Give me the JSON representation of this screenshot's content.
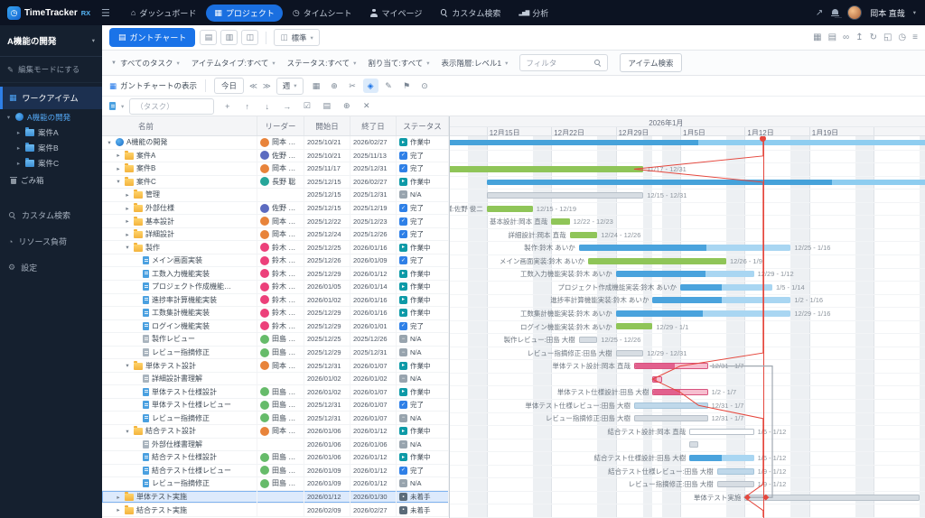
{
  "app": {
    "title": "TimeTracker",
    "title_suffix": "RX"
  },
  "header": {
    "nav": [
      {
        "label": "ダッシュボード",
        "icon": "home-icon",
        "active": false
      },
      {
        "label": "プロジェクト",
        "icon": "grid-icon",
        "active": true
      },
      {
        "label": "タイムシート",
        "icon": "timesheet-icon",
        "active": false
      },
      {
        "label": "マイページ",
        "icon": "user-icon",
        "active": false
      },
      {
        "label": "カスタム検索",
        "icon": "search-icon",
        "active": false
      },
      {
        "label": "分析",
        "icon": "chart-icon",
        "active": false
      }
    ],
    "user_name": "岡本 直哉"
  },
  "sidebar": {
    "project_selector": "A機能の開発",
    "edit_mode_label": "編集モードにする",
    "workitem_label": "ワークアイテム",
    "tree": [
      {
        "label": "A機能の開発",
        "level": 0,
        "selected": true,
        "expanded": true,
        "icon": "project-icon"
      },
      {
        "label": "案件A",
        "level": 1,
        "icon": "folder-icon"
      },
      {
        "label": "案件B",
        "level": 1,
        "icon": "folder-icon"
      },
      {
        "label": "案件C",
        "level": 1,
        "icon": "folder-icon"
      }
    ],
    "trash_label": "ごみ箱",
    "menu": [
      {
        "label": "カスタム検索",
        "icon": "search-icon"
      },
      {
        "label": "リソース負荷",
        "icon": "load-icon"
      },
      {
        "label": "設定",
        "icon": "gear-icon"
      }
    ]
  },
  "toolbar": {
    "view_button": "ガントチャート",
    "view_icons": [
      "list-icon",
      "board-icon",
      "columns-icon"
    ],
    "preset": "標準",
    "right_icons": [
      "grid-icon",
      "list-icon",
      "link-icon",
      "upload-icon",
      "refresh-icon",
      "frame-icon",
      "clock-icon",
      "menu-icon"
    ]
  },
  "filters": {
    "chips": [
      "すべてのタスク",
      "アイテムタイプ:すべて",
      "ステータス:すべて",
      "割り当て:すべて",
      "表示階層:レベル1"
    ],
    "filter_placeholder": "フィルタ",
    "search_button": "アイテム検索"
  },
  "gantt_toolbar": {
    "show_label": "ガントチャートの表示",
    "today_button": "今日",
    "zoom_level": "週",
    "icons": [
      "grid-icon",
      "zoom-icon",
      "scissors-icon",
      "diamond-icon",
      "pen-icon",
      "flag-icon",
      "comment-icon"
    ],
    "active_icon_index": 3
  },
  "row_toolbar": {
    "task_placeholder": "（タスク）",
    "icons": [
      "plus-icon",
      "up-icon",
      "down-icon",
      "indent-icon",
      "check-icon",
      "list-icon",
      "zoom-icon",
      "close-icon"
    ]
  },
  "table": {
    "columns": [
      "名前",
      "リーダー",
      "開始日",
      "終了日",
      "ステータス"
    ],
    "rows": [
      {
        "name": "A機能の開発",
        "level": 0,
        "icon": "project",
        "expand": "open",
        "leader": "岡本 直哉",
        "start": "2025/10/21",
        "end": "2026/02/27",
        "status": "作業中"
      },
      {
        "name": "案件A",
        "level": 1,
        "icon": "folder",
        "expand": "closed",
        "leader": "佐野 俊二",
        "start": "2025/10/21",
        "end": "2025/11/13",
        "status": "完了"
      },
      {
        "name": "案件B",
        "level": 1,
        "icon": "folder",
        "expand": "closed",
        "leader": "岡本 直哉",
        "start": "2025/11/17",
        "end": "2025/12/31",
        "status": "完了"
      },
      {
        "name": "案件C",
        "level": 1,
        "icon": "folder",
        "expand": "open",
        "leader": "長野 聡",
        "start": "2025/12/15",
        "end": "2026/02/27",
        "status": "作業中"
      },
      {
        "name": "管理",
        "level": 2,
        "icon": "folder",
        "expand": "closed",
        "leader": "",
        "start": "2025/12/15",
        "end": "2025/12/31",
        "status": "N/A"
      },
      {
        "name": "外部仕様",
        "level": 2,
        "icon": "folder",
        "expand": "closed",
        "leader": "佐野 俊二",
        "start": "2025/12/15",
        "end": "2025/12/19",
        "status": "完了"
      },
      {
        "name": "基本設計",
        "level": 2,
        "icon": "folder",
        "expand": "closed",
        "leader": "岡本 直哉",
        "start": "2025/12/22",
        "end": "2025/12/23",
        "status": "完了"
      },
      {
        "name": "詳細設計",
        "level": 2,
        "icon": "folder",
        "expand": "closed",
        "leader": "岡本 直哉",
        "start": "2025/12/24",
        "end": "2025/12/26",
        "status": "完了"
      },
      {
        "name": "製作",
        "level": 2,
        "icon": "folder",
        "expand": "open",
        "leader": "鈴木 あ…",
        "start": "2025/12/25",
        "end": "2026/01/16",
        "status": "作業中"
      },
      {
        "name": "メイン画面実装",
        "level": 3,
        "icon": "doc",
        "leader": "鈴木 あ…",
        "start": "2025/12/26",
        "end": "2026/01/09",
        "status": "完了"
      },
      {
        "name": "工数入力機能実装",
        "level": 3,
        "icon": "doc",
        "leader": "鈴木 あ…",
        "start": "2025/12/29",
        "end": "2026/01/12",
        "status": "作業中"
      },
      {
        "name": "プロジェクト作成機能…",
        "level": 3,
        "icon": "doc",
        "leader": "鈴木 あ…",
        "start": "2026/01/05",
        "end": "2026/01/14",
        "status": "作業中"
      },
      {
        "name": "進捗率計算機能実装",
        "level": 3,
        "icon": "doc",
        "leader": "鈴木 あ…",
        "start": "2026/01/02",
        "end": "2026/01/16",
        "status": "作業中"
      },
      {
        "name": "工数集計機能実装",
        "level": 3,
        "icon": "doc",
        "leader": "鈴木 あ…",
        "start": "2025/12/29",
        "end": "2026/01/16",
        "status": "作業中"
      },
      {
        "name": "ログイン機能実装",
        "level": 3,
        "icon": "doc",
        "leader": "鈴木 あ…",
        "start": "2025/12/29",
        "end": "2026/01/01",
        "status": "完了"
      },
      {
        "name": "製作レビュー",
        "level": 3,
        "icon": "doc-gray",
        "leader": "田島 大樹",
        "start": "2025/12/25",
        "end": "2025/12/26",
        "status": "N/A"
      },
      {
        "name": "レビュー指摘修正",
        "level": 3,
        "icon": "doc-gray",
        "leader": "田島 大樹",
        "start": "2025/12/29",
        "end": "2025/12/31",
        "status": "N/A"
      },
      {
        "name": "単体テスト設計",
        "level": 2,
        "icon": "folder",
        "expand": "open",
        "leader": "岡本 直哉",
        "start": "2025/12/31",
        "end": "2026/01/07",
        "status": "作業中"
      },
      {
        "name": "詳細設計書理解",
        "level": 3,
        "icon": "doc-gray",
        "leader": "",
        "start": "2026/01/02",
        "end": "2026/01/02",
        "status": "N/A"
      },
      {
        "name": "単体テスト仕様設計",
        "level": 3,
        "icon": "doc",
        "leader": "田島 大樹",
        "start": "2026/01/02",
        "end": "2026/01/07",
        "status": "作業中"
      },
      {
        "name": "単体テスト仕様レビュー",
        "level": 3,
        "icon": "doc",
        "leader": "田島 大樹",
        "start": "2025/12/31",
        "end": "2026/01/07",
        "status": "完了"
      },
      {
        "name": "レビュー指摘修正",
        "level": 3,
        "icon": "doc",
        "leader": "田島 大樹",
        "start": "2025/12/31",
        "end": "2026/01/07",
        "status": "N/A"
      },
      {
        "name": "結合テスト設計",
        "level": 2,
        "icon": "folder",
        "expand": "open",
        "leader": "岡本 直哉",
        "start": "2026/01/06",
        "end": "2026/01/12",
        "status": "作業中"
      },
      {
        "name": "外部仕様書理解",
        "level": 3,
        "icon": "doc-gray",
        "leader": "",
        "start": "2026/01/06",
        "end": "2026/01/06",
        "status": "N/A"
      },
      {
        "name": "結合テスト仕様設計",
        "level": 3,
        "icon": "doc",
        "leader": "田島 大樹",
        "start": "2026/01/06",
        "end": "2026/01/12",
        "status": "作業中"
      },
      {
        "name": "結合テスト仕様レビュー",
        "level": 3,
        "icon": "doc",
        "leader": "田島 大樹",
        "start": "2026/01/09",
        "end": "2026/01/12",
        "status": "完了"
      },
      {
        "name": "レビュー指摘修正",
        "level": 3,
        "icon": "doc",
        "leader": "田島 大樹",
        "start": "2026/01/09",
        "end": "2026/01/12",
        "status": "N/A"
      },
      {
        "name": "単体テスト実施",
        "level": 1,
        "icon": "folder",
        "expand": "closed",
        "leader": "",
        "start": "2026/01/12",
        "end": "2026/01/30",
        "status": "未着手",
        "selected": true
      },
      {
        "name": "結合テスト実施",
        "level": 1,
        "icon": "folder",
        "expand": "closed",
        "leader": "",
        "start": "2026/02/09",
        "end": "2026/02/27",
        "status": "未着手"
      }
    ]
  },
  "status_colors": {
    "完了": "#2f80e7",
    "作業中": "#0e9aa7",
    "N/A": "#98a4ae",
    "未着手": "#5b6b79"
  },
  "chart_data": {
    "type": "gantt",
    "timeline": {
      "visible_start": "2025-12-11",
      "day_width": 10.2,
      "months": [
        {
          "date": "2026-01-01",
          "label": "2026年1月"
        }
      ],
      "weeks": [
        {
          "date": "2025-12-15",
          "label": "12月15日"
        },
        {
          "date": "2025-12-22",
          "label": "12月22日"
        },
        {
          "date": "2025-12-29",
          "label": "12月29日"
        },
        {
          "date": "2026-01-05",
          "label": "1月5日"
        },
        {
          "date": "2026-01-12",
          "label": "1月12日"
        },
        {
          "date": "2026-01-19",
          "label": "1月19日"
        }
      ],
      "holidays": [
        "2026-01-01"
      ]
    },
    "today": "2026-01-14",
    "bars": [
      {
        "row": 0,
        "start": "2025-10-21",
        "end": "2026-02-27",
        "color": "summary",
        "progress": 0.6
      },
      {
        "row": 1,
        "start": "2025-10-21",
        "end": "2025-11-13",
        "color": "green",
        "progress": 1
      },
      {
        "row": 2,
        "start": "2025-11-17",
        "end": "2025-12-31",
        "color": "green",
        "progress": 1,
        "label_right": "11/17 - 12/31"
      },
      {
        "row": 3,
        "start": "2025-12-15",
        "end": "2026-02-27",
        "color": "summary",
        "progress": 0.5
      },
      {
        "row": 4,
        "start": "2025-12-15",
        "end": "2025-12-31",
        "color": "gray",
        "label_right": "12/15 - 12/31"
      },
      {
        "row": 5,
        "start": "2025-12-15",
        "end": "2025-12-19",
        "color": "green",
        "progress": 1,
        "label_left": "外部仕様:佐野 俊二",
        "label_right": "12/15 - 12/19"
      },
      {
        "row": 6,
        "start": "2025-12-22",
        "end": "2025-12-23",
        "color": "green",
        "progress": 1,
        "label_left": "基本設計:岡本 直哉",
        "label_right": "12/22 - 12/23"
      },
      {
        "row": 7,
        "start": "2025-12-24",
        "end": "2025-12-26",
        "color": "green",
        "progress": 1,
        "label_left": "詳細設計:岡本 直哉",
        "label_right": "12/24 - 12/26"
      },
      {
        "row": 8,
        "start": "2025-12-25",
        "end": "2026-01-16",
        "color": "blue",
        "progress": 0.6,
        "label_left": "製作:鈴木 あいか",
        "label_right": "12/25 - 1/16"
      },
      {
        "row": 9,
        "start": "2025-12-26",
        "end": "2026-01-09",
        "color": "green",
        "progress": 1,
        "label_left": "メイン画面実装:鈴木 あいか",
        "label_right": "12/26 - 1/9"
      },
      {
        "row": 10,
        "start": "2025-12-29",
        "end": "2026-01-12",
        "color": "blue",
        "progress": 0.65,
        "label_left": "工数入力機能実装:鈴木 あいか",
        "label_right": "12/29 - 1/12"
      },
      {
        "row": 11,
        "start": "2026-01-05",
        "end": "2026-01-14",
        "color": "blue",
        "progress": 0.45,
        "label_left": "プロジェクト作成機能実装:鈴木 あいか",
        "label_right": "1/5 - 1/14"
      },
      {
        "row": 12,
        "start": "2026-01-02",
        "end": "2026-01-16",
        "color": "blue",
        "progress": 0.5,
        "label_left": "進捗率計算機能実装:鈴木 あいか",
        "label_right": "1/2 - 1/16"
      },
      {
        "row": 13,
        "start": "2025-12-29",
        "end": "2026-01-16",
        "color": "blue",
        "progress": 0.5,
        "label_left": "工数集計機能実装:鈴木 あいか",
        "label_right": "12/29 - 1/16"
      },
      {
        "row": 14,
        "start": "2025-12-29",
        "end": "2026-01-01",
        "color": "green",
        "progress": 1,
        "label_left": "ログイン機能実装:鈴木 あいか",
        "label_right": "12/29 - 1/1"
      },
      {
        "row": 15,
        "start": "2025-12-25",
        "end": "2025-12-26",
        "color": "gray",
        "label_left": "製作レビュー:田島 大樹",
        "label_right": "12/25 - 12/26"
      },
      {
        "row": 16,
        "start": "2025-12-29",
        "end": "2025-12-31",
        "color": "gray",
        "label_left": "レビュー指摘修正:田島 大樹",
        "label_right": "12/29 - 12/31"
      },
      {
        "row": 17,
        "start": "2025-12-31",
        "end": "2026-01-07",
        "color": "pink",
        "progress": 0.55,
        "label_left": "単体テスト設計:岡本 直哉",
        "label_right": "12/31 - 1/7"
      },
      {
        "row": 18,
        "start": "2026-01-02",
        "end": "2026-01-02",
        "color": "pink",
        "progress": 0.5
      },
      {
        "row": 19,
        "start": "2026-01-02",
        "end": "2026-01-07",
        "color": "pink",
        "progress": 0.5,
        "label_left": "単体テスト仕様設計:田島 大樹",
        "label_right": "1/2 - 1/7"
      },
      {
        "row": 20,
        "start": "2025-12-31",
        "end": "2026-01-07",
        "color": "grayblue",
        "label_left": "単体テスト仕様レビュー:田島 大樹",
        "label_right": "12/31 - 1/7"
      },
      {
        "row": 21,
        "start": "2025-12-31",
        "end": "2026-01-07",
        "color": "gray",
        "label_left": "レビュー指摘修正:田島 大樹",
        "label_right": "12/31 - 1/7"
      },
      {
        "row": 22,
        "start": "2026-01-06",
        "end": "2026-01-12",
        "color": "outline",
        "label_left": "結合テスト設計:岡本 直哉",
        "label_right": "1/6 - 1/12"
      },
      {
        "row": 23,
        "start": "2026-01-06",
        "end": "2026-01-06",
        "color": "gray"
      },
      {
        "row": 24,
        "start": "2026-01-06",
        "end": "2026-01-12",
        "color": "blue",
        "progress": 0.5,
        "label_left": "結合テスト仕様設計:田島 大樹",
        "label_right": "1/6 - 1/12"
      },
      {
        "row": 25,
        "start": "2026-01-09",
        "end": "2026-01-12",
        "color": "grayblue",
        "label_left": "結合テスト仕様レビュー:田島 大樹",
        "label_right": "1/9 - 1/12"
      },
      {
        "row": 26,
        "start": "2026-01-09",
        "end": "2026-01-12",
        "color": "gray",
        "label_left": "レビュー指摘修正:田島 大樹",
        "label_right": "1/9 - 1/12"
      },
      {
        "row": 27,
        "start": "2026-01-12",
        "end": "2026-01-30",
        "color": "gray",
        "label_left": "単体テスト実施"
      },
      {
        "row": 28,
        "start": "2026-02-09",
        "end": "2026-02-27",
        "color": "gray"
      }
    ],
    "progress_line": {
      "2": "2025-12-31",
      "17": "2026-01-05",
      "18": "2026-01-02",
      "19": "2026-01-05",
      "20": "2026-01-07",
      "27": "2026-01-12"
    },
    "connectors": [
      {
        "from_row": 17,
        "via_date": "2026-01-15",
        "to_row": 27,
        "to_date": "2026-01-12"
      }
    ],
    "markers": [
      {
        "row": 27,
        "date": "2026-01-12"
      },
      {
        "row": 27,
        "date": "2026-01-14"
      }
    ]
  }
}
